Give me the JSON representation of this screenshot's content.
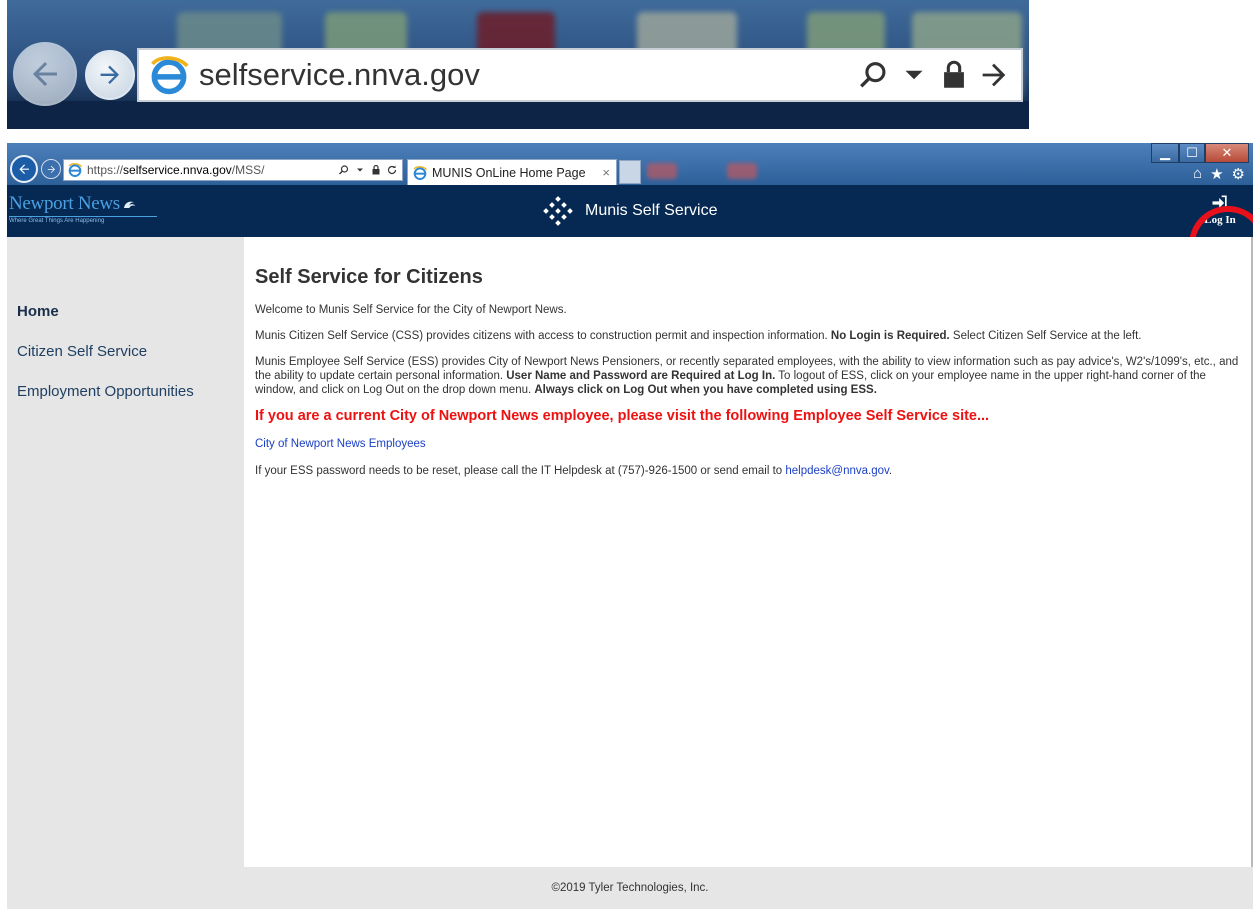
{
  "zoom_inset": {
    "url": "selfservice.nnva.gov"
  },
  "browser": {
    "address": {
      "scheme": "https://",
      "host": "selfservice.nnva.gov",
      "path": "/MSS/"
    },
    "tab_title": "MUNIS OnLine Home Page",
    "tab_close": "×"
  },
  "header": {
    "brand_name": "Newport News",
    "brand_tagline": "Where Great Things Are Happening",
    "app_title": "Munis Self Service",
    "login_label": "Log In"
  },
  "sidebar": {
    "items": [
      {
        "label": "Home",
        "active": true
      },
      {
        "label": "Citizen Self Service",
        "active": false
      },
      {
        "label": "Employment Opportunities",
        "active": false
      }
    ]
  },
  "main": {
    "title": "Self Service for Citizens",
    "welcome": "Welcome to Munis Self Service for the City of Newport News.",
    "css_text_1": "Munis Citizen Self Service (CSS) provides citizens with access to construction permit and inspection information. ",
    "css_bold": "No Login is Required.",
    "css_text_2": " Select Citizen Self Service at the left.",
    "ess_text_1": "Munis Employee Self Service (ESS) provides City of Newport News Pensioners, or recently separated employees, with the ability to view information such as pay advice's, W2's/1099's, etc., and the ability to update certain personal information. ",
    "ess_bold_1": "User Name and Password are Required at Log In.",
    "ess_text_2": " To logout of ESS, click on your employee name in the upper right-hand corner of the window, and click on Log Out on the drop down menu. ",
    "ess_bold_2": "Always click on Log Out when you have completed using ESS.",
    "notice": "If you are a current City of Newport News employee, please visit the following Employee Self Service site...",
    "employee_link": "City of Newport News Employees",
    "reset_text": "If your ESS password needs to be reset, please call the IT Helpdesk at (757)-926-1500 or send email to ",
    "helpdesk_email": "helpdesk@nnva.gov",
    "reset_end": "."
  },
  "footer": {
    "copyright": "©2019 Tyler Technologies, Inc."
  },
  "colors": {
    "header_bg": "#052953",
    "sidebar_bg": "#e6e6e6",
    "notice_red": "#ee1111",
    "link_blue": "#1a3fc4",
    "highlight_circle": "#e8101a"
  }
}
